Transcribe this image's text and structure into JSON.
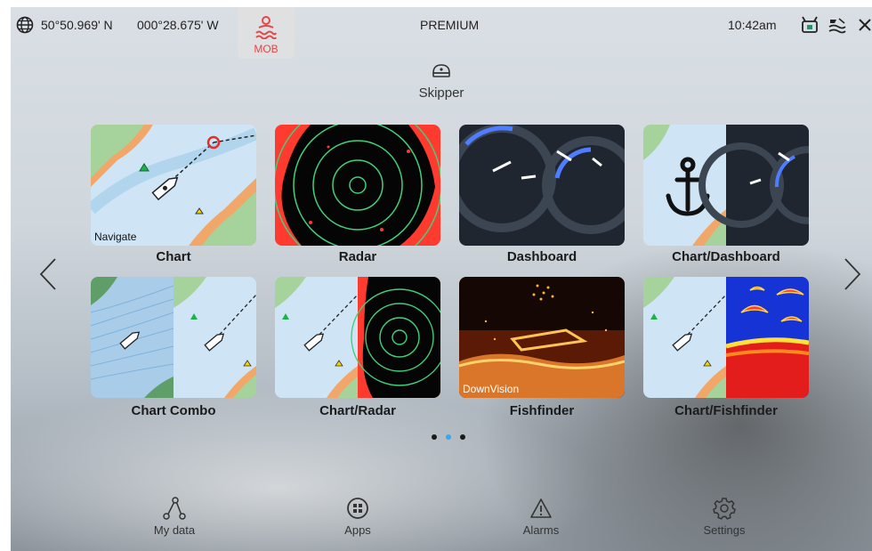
{
  "status_bar": {
    "latitude": "50°50.969' N",
    "longitude": "000°28.675' W",
    "mob_label": "MOB",
    "mode": "PREMIUM",
    "time": "10:42am"
  },
  "profile": {
    "name": "Skipper"
  },
  "apps": [
    {
      "label": "Chart",
      "overlay": "Navigate"
    },
    {
      "label": "Radar"
    },
    {
      "label": "Dashboard"
    },
    {
      "label": "Chart/Dashboard"
    },
    {
      "label": "Chart Combo"
    },
    {
      "label": "Chart/Radar"
    },
    {
      "label": "Fishfinder",
      "overlay": "DownVision"
    },
    {
      "label": "Chart/Fishfinder"
    }
  ],
  "pagination": {
    "pages": 3,
    "current": 2
  },
  "bottom_nav": {
    "my_data": "My data",
    "apps": "Apps",
    "alarms": "Alarms",
    "settings": "Settings"
  },
  "colors": {
    "mob_red": "#e04848",
    "active_dot": "#3ba7f0",
    "radar_green": "#3fd17a",
    "dial_blue": "#4f7dff"
  }
}
